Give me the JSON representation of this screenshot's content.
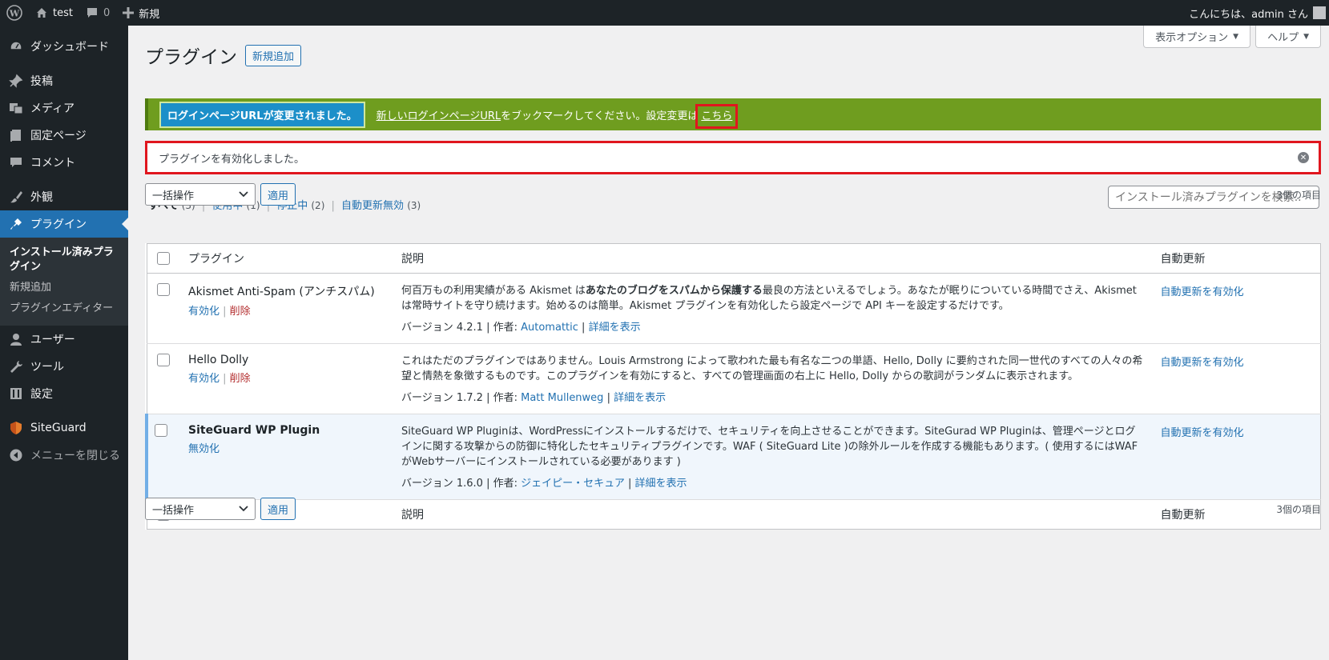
{
  "adminbar": {
    "site_name": "test",
    "comments_count": "0",
    "new_label": "新規",
    "greeting": "こんにちは、admin さん"
  },
  "sidebar": {
    "items": [
      {
        "label": "ダッシュボード",
        "icon": "dashboard-icon"
      },
      {
        "label": "投稿",
        "icon": "pin-icon"
      },
      {
        "label": "メディア",
        "icon": "media-icon"
      },
      {
        "label": "固定ページ",
        "icon": "page-icon"
      },
      {
        "label": "コメント",
        "icon": "comment-icon"
      },
      {
        "label": "外観",
        "icon": "brush-icon"
      },
      {
        "label": "プラグイン",
        "icon": "plugin-icon"
      },
      {
        "label": "ユーザー",
        "icon": "user-icon"
      },
      {
        "label": "ツール",
        "icon": "wrench-icon"
      },
      {
        "label": "設定",
        "icon": "settings-icon"
      },
      {
        "label": "SiteGuard",
        "icon": "shield-icon"
      },
      {
        "label": "メニューを閉じる",
        "icon": "collapse-icon"
      }
    ],
    "submenu": [
      "インストール済みプラグイン",
      "新規追加",
      "プラグインエディター"
    ]
  },
  "screen_meta": {
    "options": "表示オプション",
    "help": "ヘルプ"
  },
  "page": {
    "title": "プラグイン",
    "add_new": "新規追加"
  },
  "notice_login": {
    "tag": "ログインページURLが変更されました。",
    "link": "新しいログインページURL",
    "text": "をブックマークしてください。設定変更は",
    "here": "こちら"
  },
  "notice_activated": "プラグインを有効化しました。",
  "filters": {
    "all": "すべて",
    "all_count": "(3)",
    "active": "使用中",
    "active_count": "(1)",
    "inactive": "停止中",
    "inactive_count": "(2)",
    "autoupdate_off": "自動更新無効",
    "autoupdate_off_count": "(3)"
  },
  "search_placeholder": "インストール済みプラグインを検索...",
  "bulk": {
    "select": "一括操作",
    "apply": "適用",
    "items": "3個の項目"
  },
  "table": {
    "headers": {
      "plugin": "プラグイン",
      "description": "説明",
      "autoupdate": "自動更新"
    },
    "rows": [
      {
        "name": "Akismet Anti-Spam (アンチスパム)",
        "action1": "有効化",
        "action2": "削除",
        "desc_pre": "何百万もの利用実績がある Akismet は",
        "desc_bold": "あなたのブログをスパムから保護する",
        "desc_post": "最良の方法といえるでしょう。あなたが眠りについている時間でさえ、Akismet は常時サイトを守り続けます。始めるのは簡単。Akismet プラグインを有効化したら設定ページで API キーを設定するだけです。",
        "version": "バージョン 4.2.1 | 作者:",
        "author": "Automattic",
        "details": "詳細を表示",
        "autoupdate": "自動更新を有効化"
      },
      {
        "name": "Hello Dolly",
        "action1": "有効化",
        "action2": "削除",
        "desc": "これはただのプラグインではありません。Louis Armstrong によって歌われた最も有名な二つの単語、Hello, Dolly に要約された同一世代のすべての人々の希望と情熱を象徴するものです。このプラグインを有効にすると、すべての管理画面の右上に Hello, Dolly からの歌詞がランダムに表示されます。",
        "version": "バージョン 1.7.2 | 作者:",
        "author": "Matt Mullenweg",
        "details": "詳細を表示",
        "autoupdate": "自動更新を有効化"
      },
      {
        "name": "SiteGuard WP Plugin",
        "action1": "無効化",
        "desc": "SiteGuard WP Pluginは、WordPressにインストールするだけで、セキュリティを向上させることができます。SiteGurad WP Pluginは、管理ページとログインに関する攻撃からの防御に特化したセキュリティプラグインです。WAF ( SiteGuard Lite )の除外ルールを作成する機能もあります。( 使用するにはWAFがWebサーバーにインストールされている必要があります )",
        "version": "バージョン 1.6.0 | 作者:",
        "author": "ジェイピー・セキュア",
        "details": "詳細を表示",
        "autoupdate": "自動更新を有効化"
      }
    ]
  }
}
